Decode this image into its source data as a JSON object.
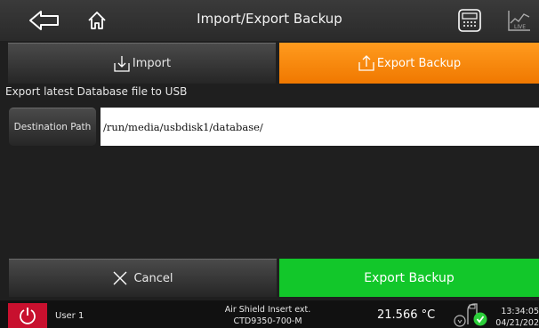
{
  "header": {
    "title": "Import/Export Backup"
  },
  "tabs": {
    "import_label": "Import",
    "export_label": "Export Backup"
  },
  "section": {
    "label": "Export latest Database file to USB"
  },
  "destination": {
    "button_label": "Destination Path",
    "path_value": "/run/media/usbdisk1/database/"
  },
  "actions": {
    "cancel_label": "Cancel",
    "export_label": "Export Backup"
  },
  "status": {
    "user": "User 1",
    "device_line1": "Air Shield Insert ext.",
    "device_line2": "CTD9350-700-M",
    "temperature": "21.566 °C",
    "time": "13:34:05",
    "date": "04/21/202",
    "connected": true
  },
  "icons": [
    "back-arrow-icon",
    "home-icon",
    "calculator-icon",
    "live-chart-icon",
    "import-icon",
    "export-icon",
    "close-x-icon",
    "power-icon",
    "probe-icon",
    "check-icon"
  ],
  "colors": {
    "accent_orange": "#f58a0b",
    "action_green": "#12c72a",
    "power_red": "#c8102e",
    "background": "#1f1f1f"
  }
}
